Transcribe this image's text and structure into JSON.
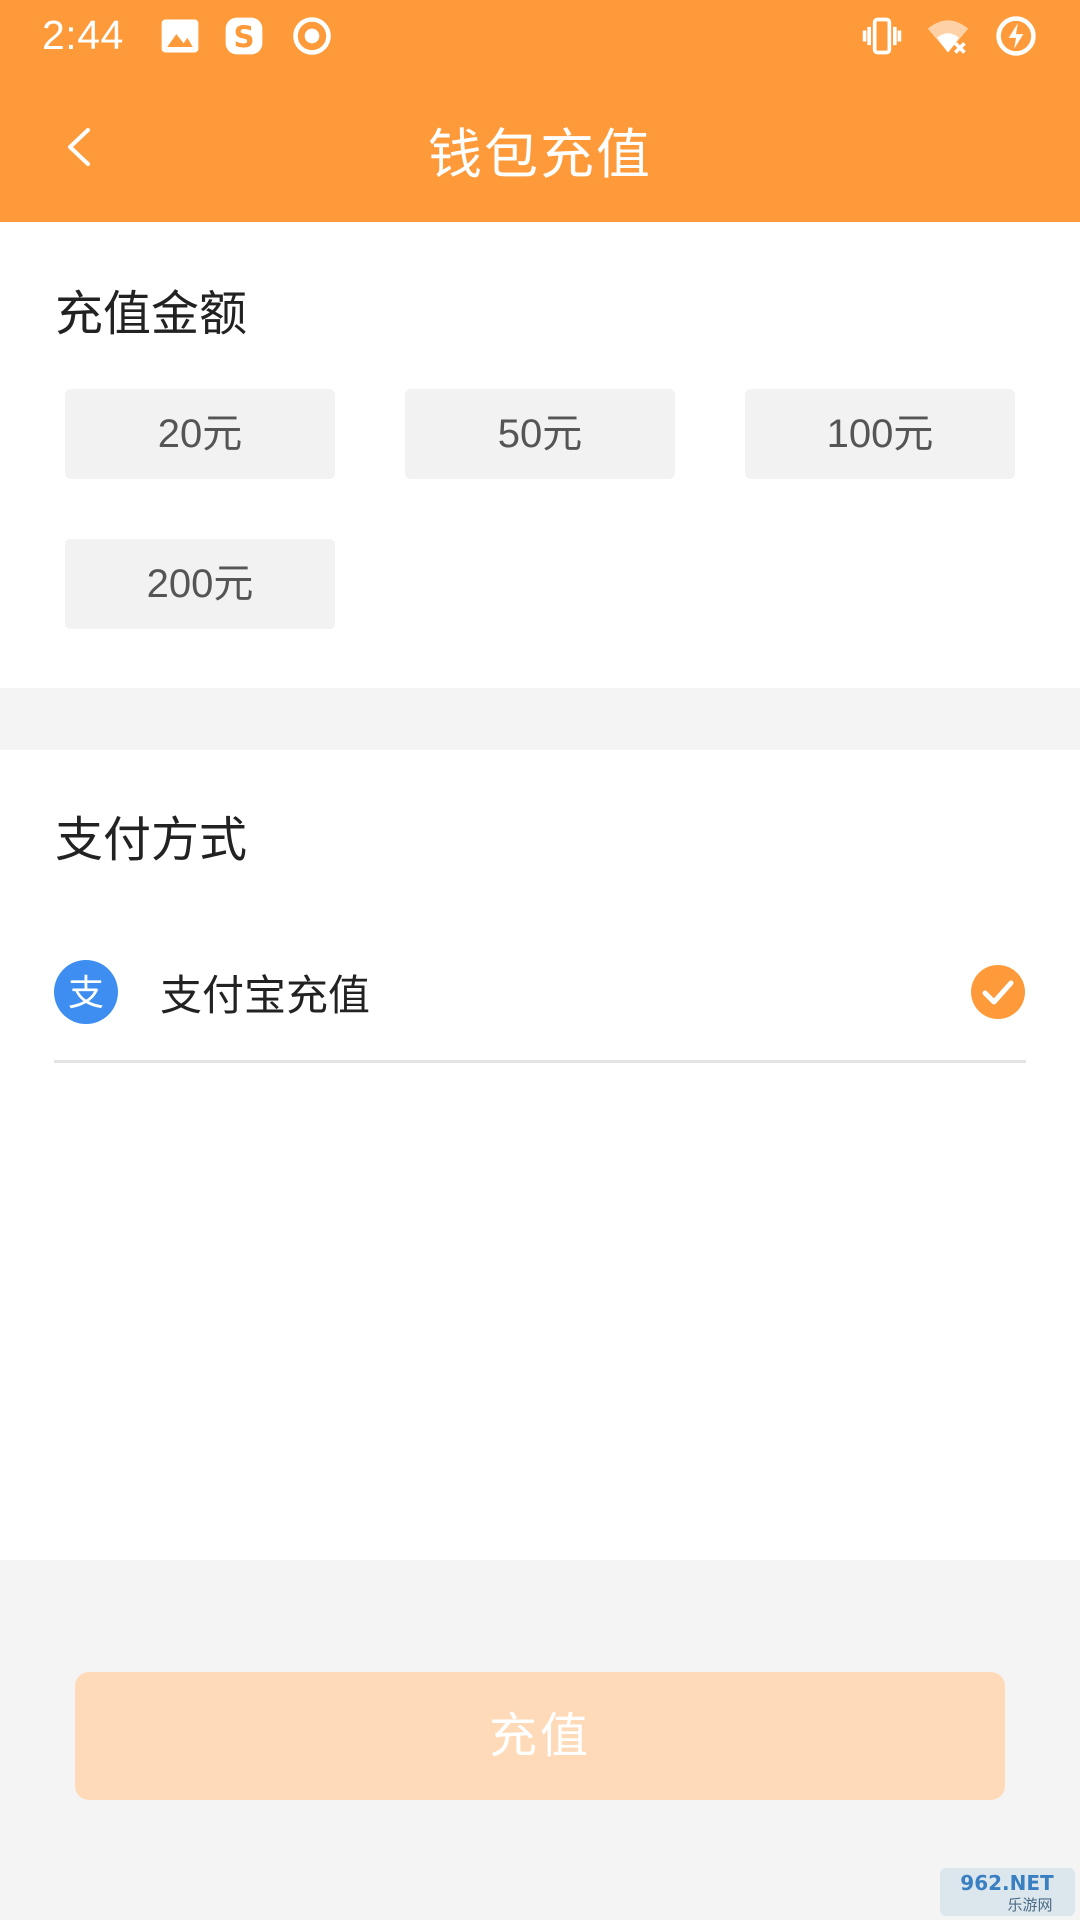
{
  "status_bar": {
    "time": "2:44",
    "icons": [
      "image-icon",
      "sogou-s-icon",
      "record-icon",
      "vibrate-icon",
      "wifi-off-icon",
      "battery-charging-icon"
    ]
  },
  "nav": {
    "title": "钱包充值",
    "back_icon": "chevron-left-icon"
  },
  "amount": {
    "title": "充值金额",
    "options": [
      "20元",
      "50元",
      "100元",
      "200元"
    ]
  },
  "payment": {
    "title": "支付方式",
    "methods": [
      {
        "label": "支付宝充值",
        "icon": "alipay-icon",
        "icon_glyph": "支",
        "selected": true
      }
    ]
  },
  "actions": {
    "recharge_label": "充值"
  },
  "watermark": {
    "text_top": "962.NET",
    "text_bottom": "乐游网"
  },
  "colors": {
    "accent": "#ff9a3a",
    "button_disabled": "#ffdab8",
    "alipay_blue": "#3d8ef0",
    "check_orange": "#ff9a3a"
  }
}
